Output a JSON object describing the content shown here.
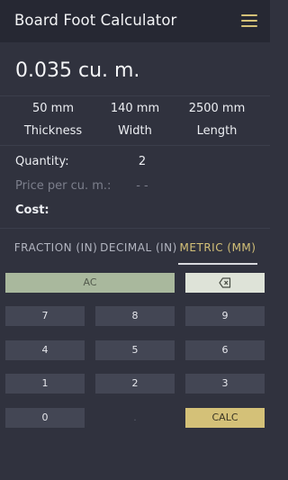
{
  "app": {
    "title": "Board Foot Calculator"
  },
  "icons": {
    "menu": "menu-icon",
    "backspace": "backspace-icon"
  },
  "colors": {
    "accent": "#d4c178",
    "background": "#30323e",
    "key": "#434654",
    "clear_key": "#a9b89d"
  },
  "result": {
    "volume": "0.035 cu. m."
  },
  "dimensions": [
    {
      "value": "50 mm",
      "label": "Thickness"
    },
    {
      "value": "140 mm",
      "label": "Width"
    },
    {
      "value": "2500 mm",
      "label": "Length"
    }
  ],
  "summary": {
    "quantity_label": "Quantity:",
    "quantity_value": "2",
    "price_label": "Price per cu. m.:",
    "price_value": "- -",
    "cost_label": "Cost:"
  },
  "tabs": [
    {
      "label": "FRACTION (IN)",
      "active": false
    },
    {
      "label": "DECIMAL (IN)",
      "active": false
    },
    {
      "label": "METRIC (MM)",
      "active": true
    }
  ],
  "keypad": {
    "clear": "AC",
    "digits": [
      "7",
      "8",
      "9",
      "4",
      "5",
      "6",
      "1",
      "2",
      "3",
      "0"
    ],
    "decimal": ".",
    "calc": "CALC"
  }
}
